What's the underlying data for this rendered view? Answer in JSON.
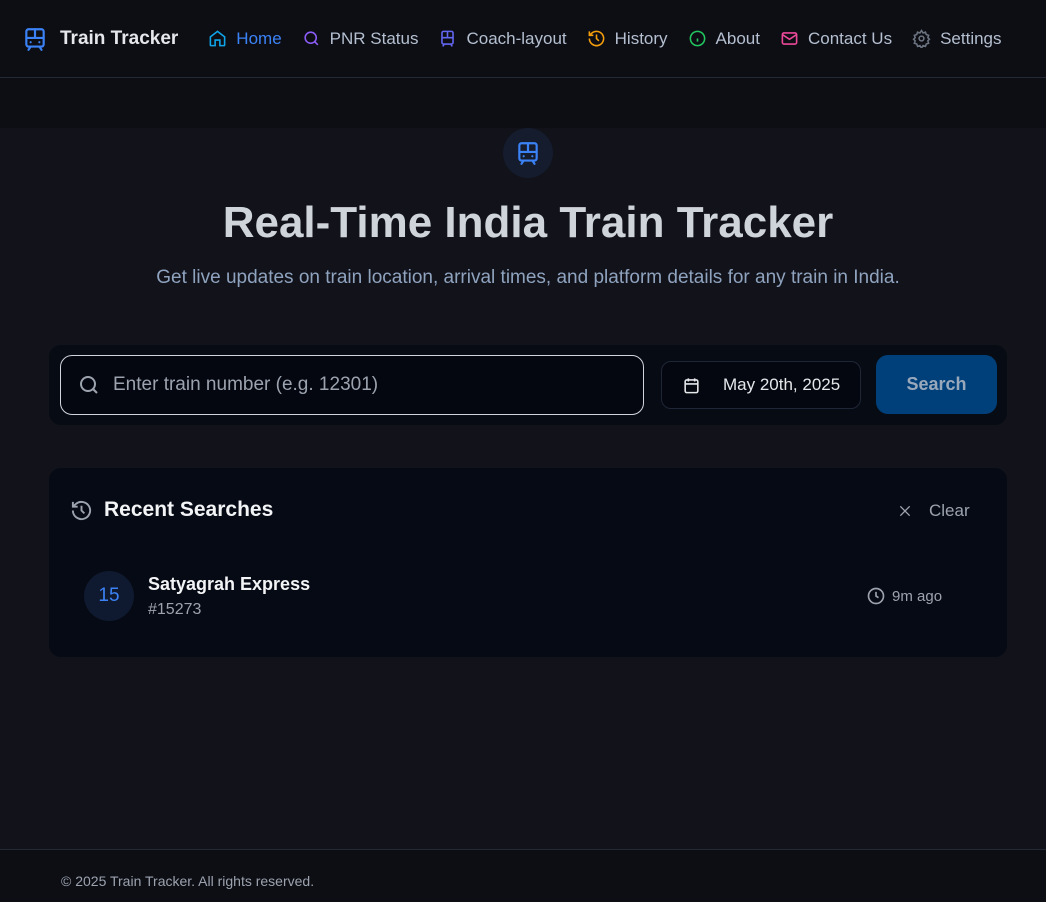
{
  "header": {
    "brand": "Train Tracker",
    "nav": [
      {
        "label": "Home",
        "icon": "home-icon",
        "color": "#3b82f6",
        "icon_color": "#0ea5e9"
      },
      {
        "label": "PNR Status",
        "icon": "search-icon",
        "color": "#b4bfd0",
        "icon_color": "#8b5cf6"
      },
      {
        "label": "Coach-layout",
        "icon": "train-icon",
        "color": "#b4bfd0",
        "icon_color": "#6366f1"
      },
      {
        "label": "History",
        "icon": "history-icon",
        "color": "#b4bfd0",
        "icon_color": "#f59e0b"
      },
      {
        "label": "About",
        "icon": "info-icon",
        "color": "#b4bfd0",
        "icon_color": "#22c55e"
      },
      {
        "label": "Contact Us",
        "icon": "mail-icon",
        "color": "#b4bfd0",
        "icon_color": "#ec4899"
      },
      {
        "label": "Settings",
        "icon": "gear-icon",
        "color": "#b4bfd0",
        "icon_color": "#6b7280"
      }
    ]
  },
  "hero": {
    "title": "Real-Time India Train Tracker",
    "subtitle": "Get live updates on train location, arrival times, and platform details for any train in India."
  },
  "search": {
    "placeholder": "Enter train number (e.g. 12301)",
    "value": "",
    "date": "May 20th, 2025",
    "button": "Search"
  },
  "recent": {
    "title": "Recent Searches",
    "clear": "Clear",
    "items": [
      {
        "badge": "15",
        "name": "Satyagrah Express",
        "number": "#15273",
        "time": "9m ago"
      }
    ]
  },
  "footer": {
    "text": "© 2025 Train Tracker. All rights reserved."
  },
  "colors": {
    "accent": "#3b82f6",
    "button": "#00407a"
  }
}
